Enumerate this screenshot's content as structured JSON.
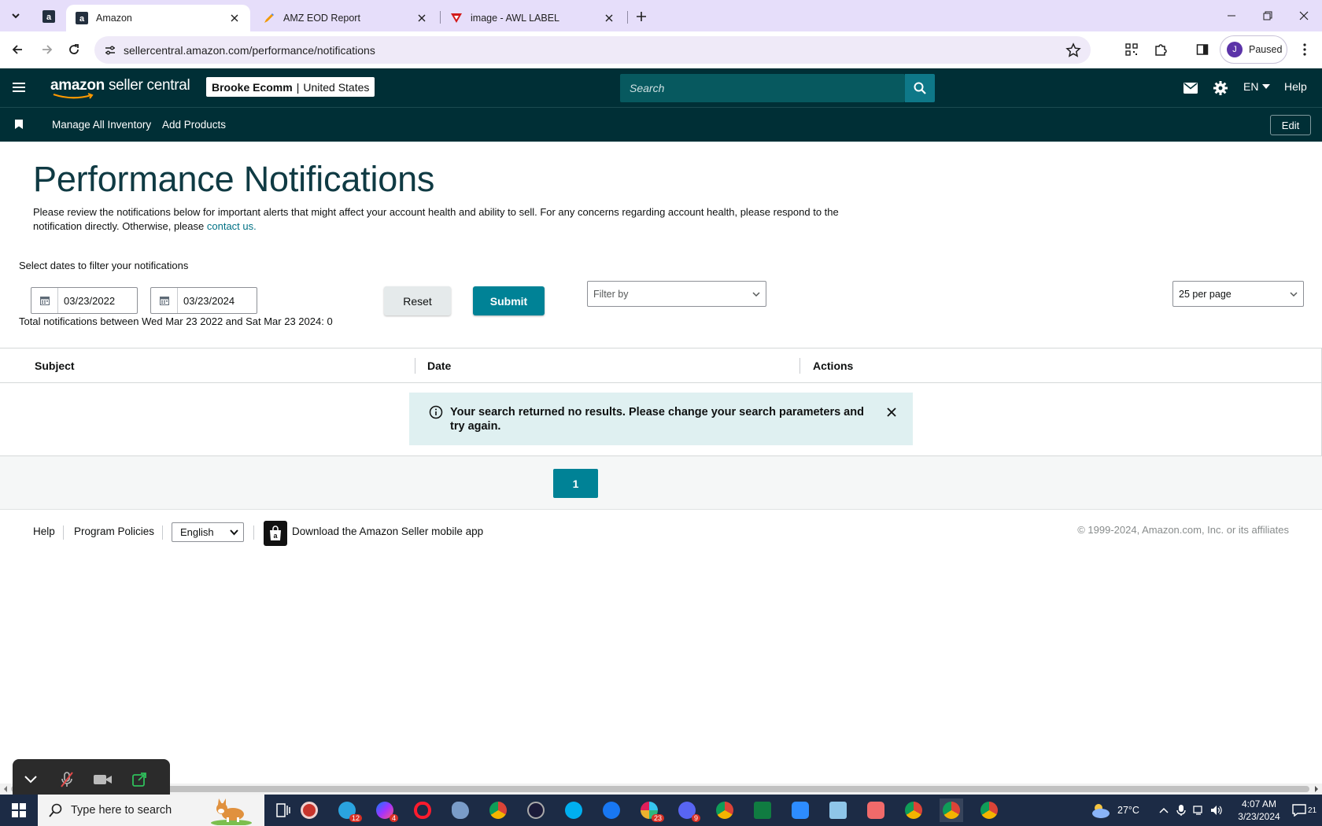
{
  "browser": {
    "tabs": [
      {
        "title": "Amazon",
        "active": true
      },
      {
        "title": "AMZ EOD Report",
        "active": false
      },
      {
        "title": "image - AWL LABEL",
        "active": false
      }
    ],
    "url": "sellercentral.amazon.com/performance/notifications",
    "profile_status": "Paused",
    "profile_initial": "J"
  },
  "header": {
    "logo_amazon": "amazon",
    "logo_seller_central": "seller central",
    "account_name": "Brooke Ecomm",
    "account_separator": "|",
    "account_region": "United States",
    "search_placeholder": "Search",
    "language": "EN",
    "help": "Help"
  },
  "nav": {
    "links": [
      "Manage All Inventory",
      "Add Products"
    ],
    "edit": "Edit"
  },
  "page": {
    "title": "Performance Notifications",
    "intro_text": "Please review the notifications below for important alerts that might affect your account health and ability to sell. For any concerns regarding account health, please respond to the notification directly. Otherwise, please ",
    "intro_link": "contact us.",
    "filter_label": "Select dates to filter your notifications",
    "start_date": "03/23/2022",
    "end_date": "03/23/2024",
    "reset": "Reset",
    "submit": "Submit",
    "filter_by": "Filter by",
    "per_page": "25 per page",
    "total_text": "Total notifications between Wed Mar 23 2022 and Sat Mar 23 2024: 0"
  },
  "table": {
    "columns": [
      "Subject",
      "Date",
      "Actions"
    ],
    "empty_message": "Your search returned no results. Please change your search parameters and try again."
  },
  "pagination": {
    "current_page": "1"
  },
  "footer": {
    "help": "Help",
    "program_policies": "Program Policies",
    "language": "English",
    "app_download": "Download the Amazon Seller mobile app",
    "copyright": "© 1999-2024, Amazon.com, Inc. or its affiliates"
  },
  "taskbar": {
    "search_placeholder": "Type here to search",
    "temperature": "27°C",
    "time": "4:07 AM",
    "date": "3/23/2024",
    "notification_count": "21",
    "badges": {
      "telegram": "12",
      "messenger": "4",
      "slack": "23",
      "discord": "9"
    }
  },
  "colors": {
    "header_bg": "#002f36",
    "accent_teal": "#008296",
    "alert_bg": "#dff0f1",
    "tabbar_bg": "#e6defa",
    "link": "#007185"
  }
}
